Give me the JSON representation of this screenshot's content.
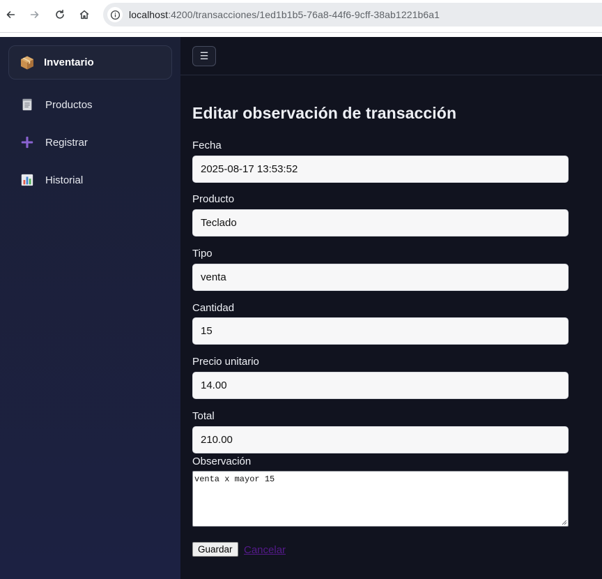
{
  "browser": {
    "url_host": "localhost",
    "url_rest": ":4200/transacciones/1ed1b1b5-76a8-44f6-9cff-38ab1221b6a1"
  },
  "sidebar": {
    "brand": {
      "icon": "package-icon",
      "label": "Inventario"
    },
    "items": [
      {
        "icon": "clipboard-icon",
        "label": "Productos"
      },
      {
        "icon": "plus-icon",
        "label": "Registrar"
      },
      {
        "icon": "bar-chart-icon",
        "label": "Historial"
      }
    ]
  },
  "topbar": {
    "menu_glyph": "☰"
  },
  "form": {
    "title": "Editar observación de transacción",
    "fields": [
      {
        "label": "Fecha",
        "value": "2025-08-17 13:53:52"
      },
      {
        "label": "Producto",
        "value": "Teclado"
      },
      {
        "label": "Tipo",
        "value": "venta"
      },
      {
        "label": "Cantidad",
        "value": "15"
      },
      {
        "label": "Precio unitario",
        "value": "14.00"
      },
      {
        "label": "Total",
        "value": "210.00"
      }
    ],
    "observation_label": "Observación",
    "observation_value": "venta x mayor 15",
    "save_label": "Guardar",
    "cancel_label": "Cancelar"
  },
  "colors": {
    "sidebar_bg": "#1b2036",
    "main_bg": "#11131f",
    "accent_plus": "#8a63d2",
    "link_visited": "#551a8b"
  }
}
